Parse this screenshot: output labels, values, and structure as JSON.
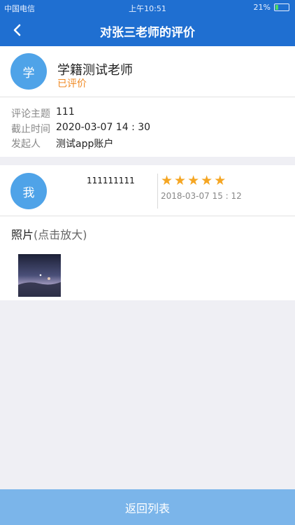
{
  "status_bar": {
    "carrier": "中国电信",
    "time": "上午10:51",
    "battery": "21%",
    "battery_level": 0.21
  },
  "header": {
    "title": "对张三老师的评价",
    "back_icon": "chevron-left-icon"
  },
  "teacher": {
    "avatar_text": "学",
    "name": "学籍测试老师",
    "status": "已评价",
    "status_color": "#f08a24"
  },
  "info": {
    "topic_label": "评论主题",
    "topic_value": "111",
    "deadline_label": "截止时间",
    "deadline_value": "2020-03-07 14 : 30",
    "initiator_label": "发起人",
    "initiator_value": "测试app账户"
  },
  "comment": {
    "avatar_text": "我",
    "text": "111111111",
    "rating": 5,
    "rating_max": 5,
    "date": "2018-03-07 15 : 12"
  },
  "photos": {
    "label": "照片",
    "hint": "(点击放大)"
  },
  "footer": {
    "button_label": "返回列表"
  },
  "colors": {
    "header": "#1f6fd1",
    "avatar": "#4fa3e8",
    "star": "#f5a623",
    "footer": "#7bb5ea"
  }
}
